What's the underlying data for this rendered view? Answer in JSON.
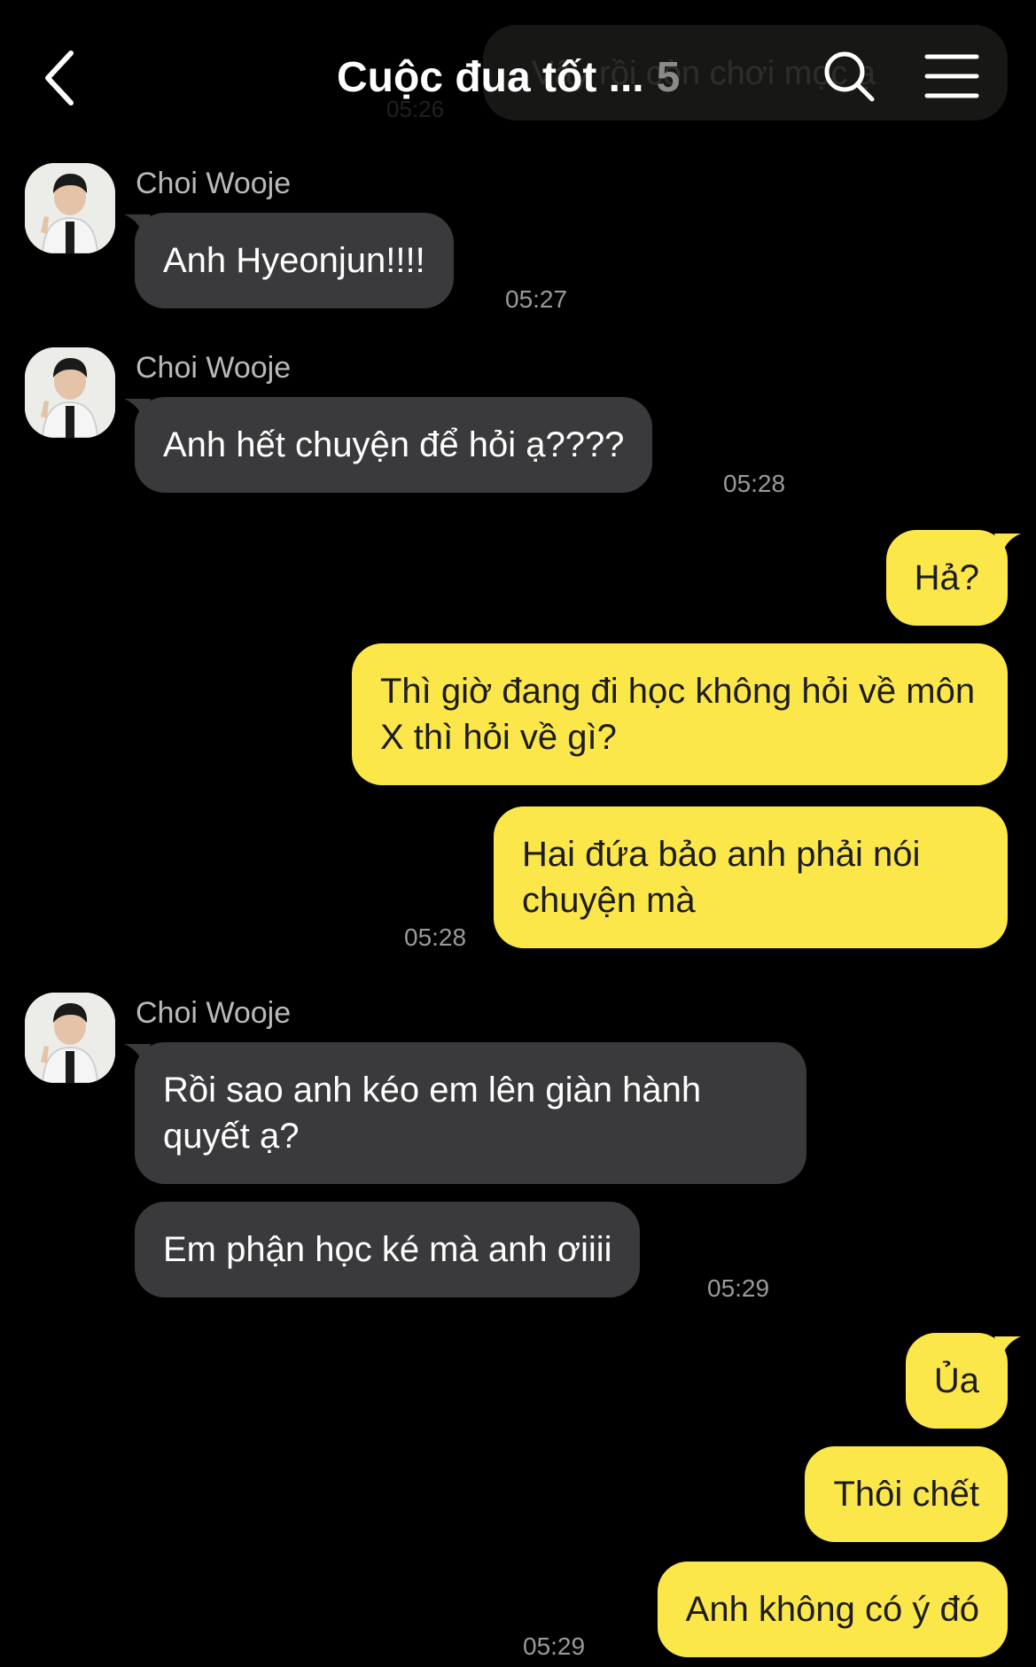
{
  "header": {
    "title": "Cuộc đua tốt ...",
    "member_count": "5",
    "ghost_preview_text": "Vậy rồi còn chơi mọc ạ",
    "ghost_preview_time": "05:26"
  },
  "messages": [
    {
      "sender": "Choi Wooje",
      "text": "Anh Hyeonjun!!!!",
      "time": "05:27"
    },
    {
      "sender": "Choi Wooje",
      "text": "Anh hết chuyện để hỏi ạ????",
      "time": "05:28"
    },
    {
      "text": "Hả?"
    },
    {
      "text": "Thì giờ đang đi học không hỏi về môn X thì hỏi về gì?"
    },
    {
      "text": "Hai đứa bảo anh phải nói chuyện mà",
      "time": "05:28"
    },
    {
      "sender": "Choi Wooje",
      "text": "Rồi sao anh kéo em lên giàn hành quyết ạ?"
    },
    {
      "text": "Em phận học ké mà anh ơiiii",
      "time": "05:29"
    },
    {
      "text": "Ủa"
    },
    {
      "text": "Thôi chết"
    },
    {
      "text": "Anh không có ý đó",
      "time": "05:29"
    }
  ],
  "colors": {
    "background": "#000000",
    "incoming_bubble": "#3a3a3c",
    "outgoing_bubble": "#fce74a",
    "timestamp": "#9a9a9a",
    "sender_name": "#b9b9b9"
  },
  "icons": {
    "back": "chevron-left-icon",
    "search": "search-icon",
    "menu": "hamburger-menu-icon"
  }
}
